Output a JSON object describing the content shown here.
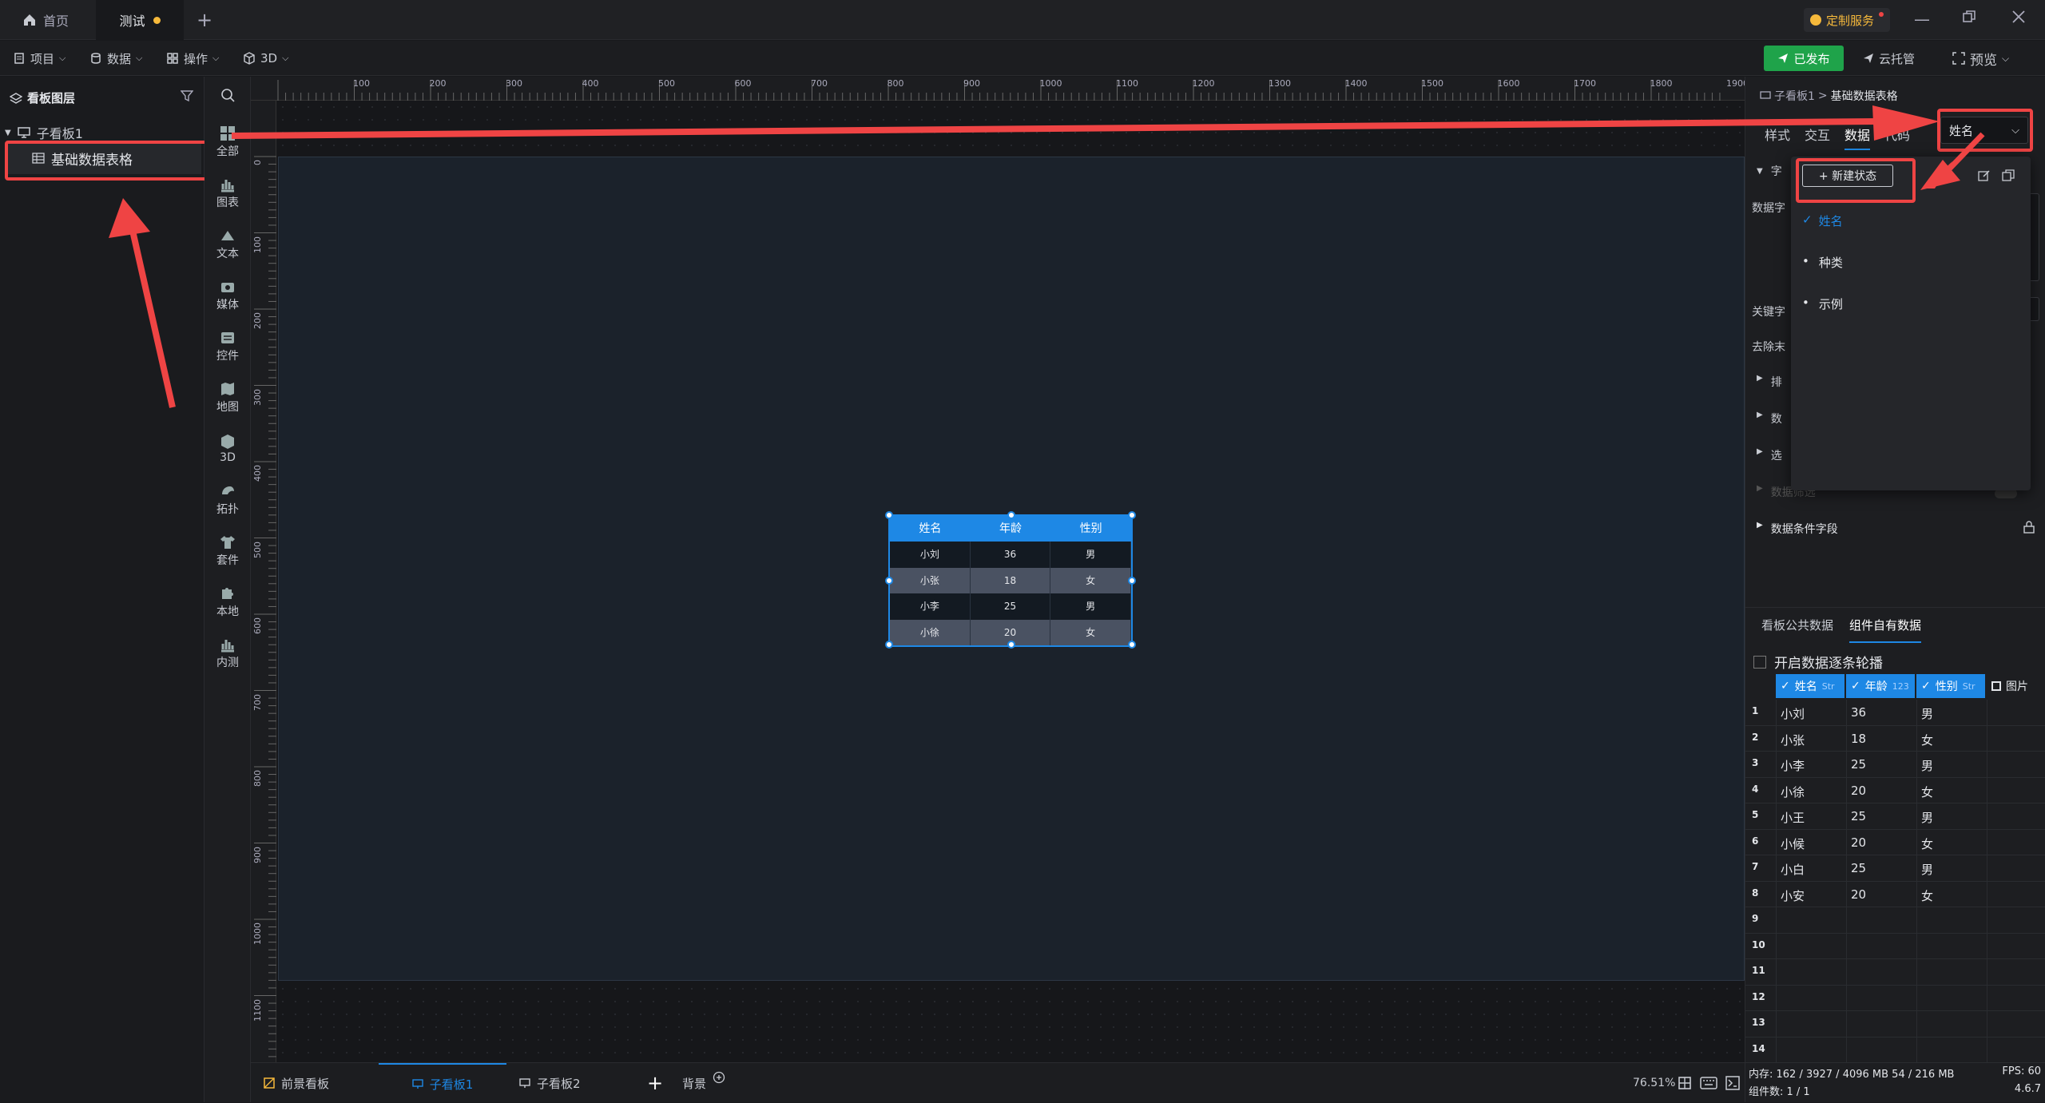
{
  "tabs": [
    {
      "label": "首页",
      "icon": "home-icon"
    },
    {
      "label": "测试",
      "modified": true
    }
  ],
  "menubar": {
    "project": "项目",
    "data": "数据",
    "operate": "操作",
    "threed": "3D",
    "publish": "已发布",
    "cloud": "云托管",
    "preview": "预览",
    "custom_service": "定制服务"
  },
  "layers": {
    "title": "看板图层",
    "board": "子看板1",
    "item": "基础数据表格"
  },
  "strip": [
    "全部",
    "图表",
    "文本",
    "媒体",
    "控件",
    "地图",
    "3D",
    "拓扑",
    "套件",
    "本地",
    "内测"
  ],
  "ruler": {
    "top": [
      "100",
      "200",
      "300",
      "400",
      "500",
      "600",
      "700",
      "800",
      "900",
      "1000",
      "1100",
      "1200",
      "1300",
      "1400",
      "1500",
      "1600",
      "1700",
      "1800",
      "1900"
    ],
    "left": [
      "0",
      "100",
      "200",
      "300",
      "400",
      "500",
      "600",
      "700",
      "800",
      "900",
      "1000",
      "1100"
    ]
  },
  "widget_table": {
    "headers": [
      "姓名",
      "年龄",
      "性别"
    ],
    "rows": [
      [
        "小刘",
        "36",
        "男"
      ],
      [
        "小张",
        "18",
        "女"
      ],
      [
        "小李",
        "25",
        "男"
      ],
      [
        "小徐",
        "20",
        "女"
      ]
    ]
  },
  "bottombar": {
    "tabs": [
      "前景看板",
      "子看板1",
      "子看板2"
    ],
    "add": "+",
    "background": "背景",
    "zoom": "76.51%"
  },
  "rpanel": {
    "breadcrumb_parent": "子看板1",
    "breadcrumb_sep": ">",
    "breadcrumb_current": "基础数据表格",
    "tabs": [
      "样式",
      "交互",
      "数据",
      "代码"
    ],
    "state_select": "姓名",
    "labels": {
      "field": "字",
      "data_field": "数据字",
      "keyword": "关键字",
      "remove": "去除末",
      "sort": "排",
      "data2": "数",
      "select": "选",
      "filter": "数据筛选",
      "condition": "数据条件字段"
    },
    "data_tabs": [
      "看板公共数据",
      "组件自有数据"
    ],
    "loop_label": "开启数据逐条轮播",
    "columns": [
      {
        "name": "姓名",
        "type": "Str"
      },
      {
        "name": "年龄",
        "type": "123"
      },
      {
        "name": "性别",
        "type": "Str"
      },
      {
        "name": "图片",
        "type": ""
      }
    ],
    "rows": [
      [
        "1",
        "小刘",
        "36",
        "男"
      ],
      [
        "2",
        "小张",
        "18",
        "女"
      ],
      [
        "3",
        "小李",
        "25",
        "男"
      ],
      [
        "4",
        "小徐",
        "20",
        "女"
      ],
      [
        "5",
        "小王",
        "25",
        "男"
      ],
      [
        "6",
        "小候",
        "20",
        "女"
      ],
      [
        "7",
        "小白",
        "25",
        "男"
      ],
      [
        "8",
        "小安",
        "20",
        "女"
      ],
      [
        "9",
        "",
        "",
        ""
      ],
      [
        "10",
        "",
        "",
        ""
      ],
      [
        "11",
        "",
        "",
        ""
      ],
      [
        "12",
        "",
        "",
        ""
      ],
      [
        "13",
        "",
        "",
        ""
      ],
      [
        "14",
        "",
        "",
        ""
      ]
    ],
    "status_memory": "内存: 162 / 3927 / 4096 MB 54 / 216 MB",
    "status_fps": "FPS: 60",
    "status_count": "组件数: 1 / 1",
    "version": "4.6.7"
  },
  "dropdown": {
    "new_state": "+ 新建状态",
    "items": [
      {
        "label": "姓名",
        "checked": true
      },
      {
        "label": "种类",
        "checked": false
      },
      {
        "label": "示例",
        "checked": false
      }
    ]
  },
  "colors": {
    "accent": "#1e88e5",
    "publish": "#1fa34a",
    "annotation": "#ef4444"
  }
}
